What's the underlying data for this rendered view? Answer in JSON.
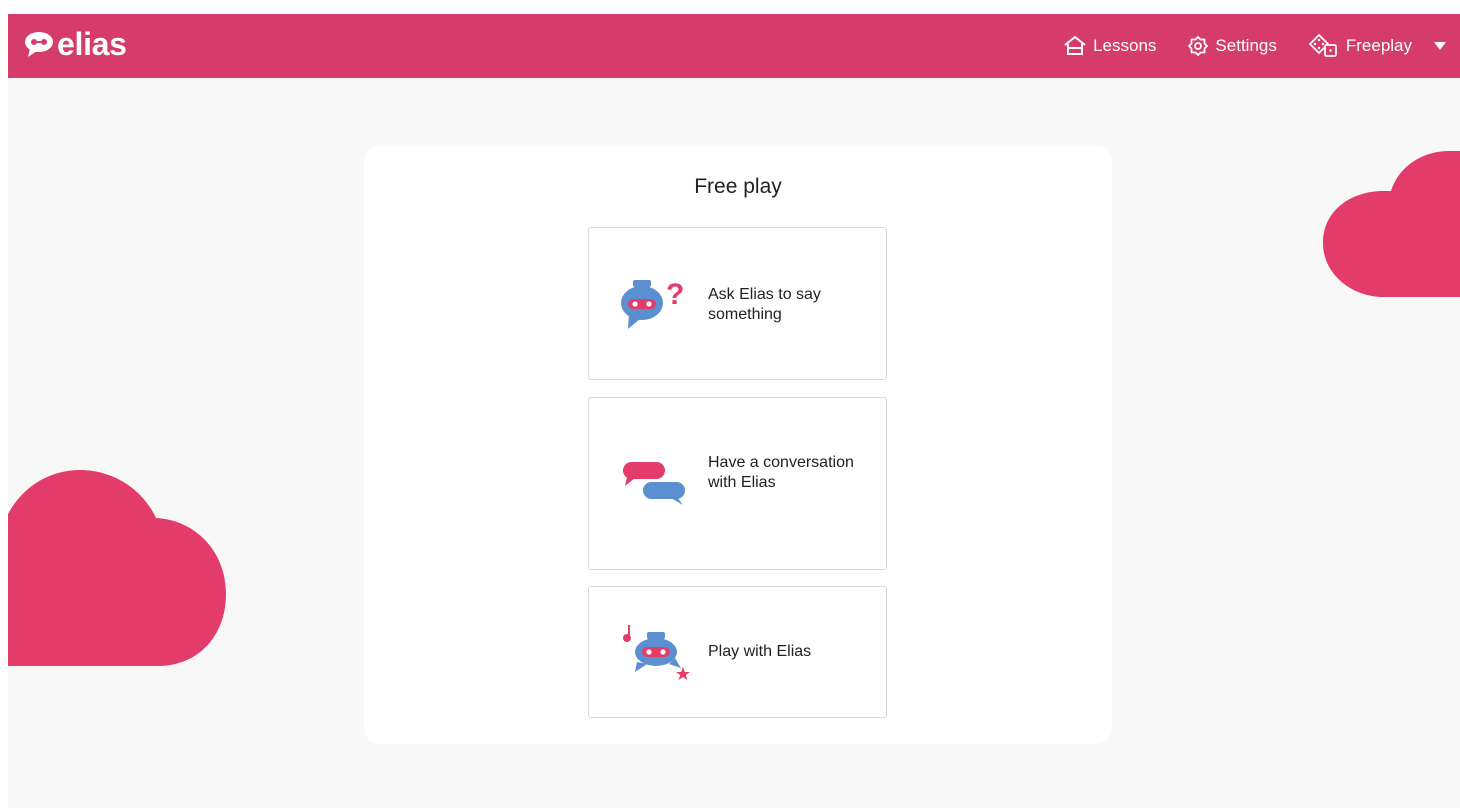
{
  "brand": {
    "name": "elias",
    "logo_icon": "chat-bubble-robot-icon"
  },
  "nav": {
    "lessons": {
      "label": "Lessons",
      "icon": "home-icon"
    },
    "settings": {
      "label": "Settings",
      "icon": "gear-icon"
    },
    "freeplay": {
      "label": "Freeplay",
      "icon": "dice-icon"
    },
    "menu_icon": "caret-down-icon"
  },
  "page": {
    "title": "Free play",
    "options": [
      {
        "label": "Ask Elias to say something",
        "icon": "robot-question-icon"
      },
      {
        "label": "Have a conversation with Elias",
        "icon": "conversation-bubbles-icon"
      },
      {
        "label": "Play with Elias",
        "icon": "robot-music-icon"
      }
    ]
  },
  "colors": {
    "brand": "#d63c6b",
    "cloud": "#e43c6a",
    "robot_blue": "#5b8fcf",
    "background": "#f8f8f8"
  }
}
